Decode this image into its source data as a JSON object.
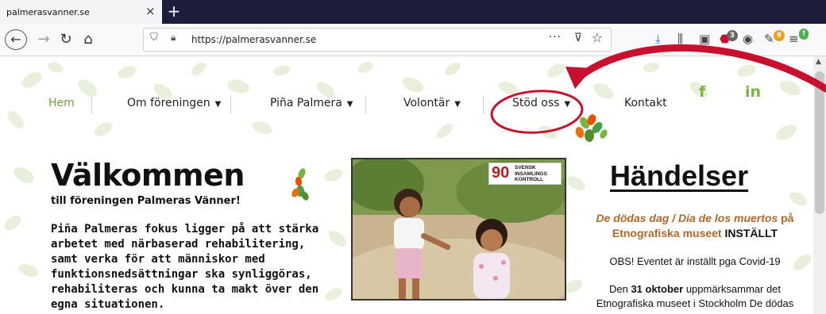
{
  "browser": {
    "tab_title": "palmerasvanner.se",
    "tab_close": "×",
    "new_tab": "+",
    "url": "https://palmerasvanner.se",
    "url_more": "···",
    "abp_count": "3",
    "ext_count": "9"
  },
  "site": {
    "nav": {
      "home": "Hem",
      "about": "Om föreningen",
      "pina": "Piña Palmera",
      "volunteer": "Volontär",
      "support": "Stöd oss",
      "contact": "Kontakt"
    },
    "social": {
      "facebook": "f",
      "linkedin": "in"
    },
    "welcome": {
      "title": "Välkommen",
      "subtitle": "till föreningen Palmeras Vänner!",
      "body": "Piña Palmeras fokus ligger på att stärka arbetet med närbaserad rehabilitering, samt verka för att människor med funktionsnedsättningar ska synliggöras, rehabiliteras och kunna ta makt över den egna situationen."
    },
    "badge": {
      "number": "90",
      "line1": "SVENSK",
      "line2": "INSAMLINGS",
      "line3": "KONTROLL"
    },
    "events": {
      "title": "Händelser",
      "event_name": "De dödas dag / Dia de los muertos",
      "event_place_prefix": "på",
      "event_place": "Etnografiska museet",
      "event_status": "INSTÄLLT",
      "note": "OBS! Eventet är inställt pga Covid-19",
      "desc_prefix": "Den",
      "desc_date": "31 oktober",
      "desc_rest": "uppmärksammar det Etnografiska museet i Stockholm De dödas"
    }
  },
  "colors": {
    "accent_green": "#6ba632",
    "annotation_red": "#c8102e",
    "event_orange": "#b5672a",
    "tabbar": "#1b1d3a"
  }
}
